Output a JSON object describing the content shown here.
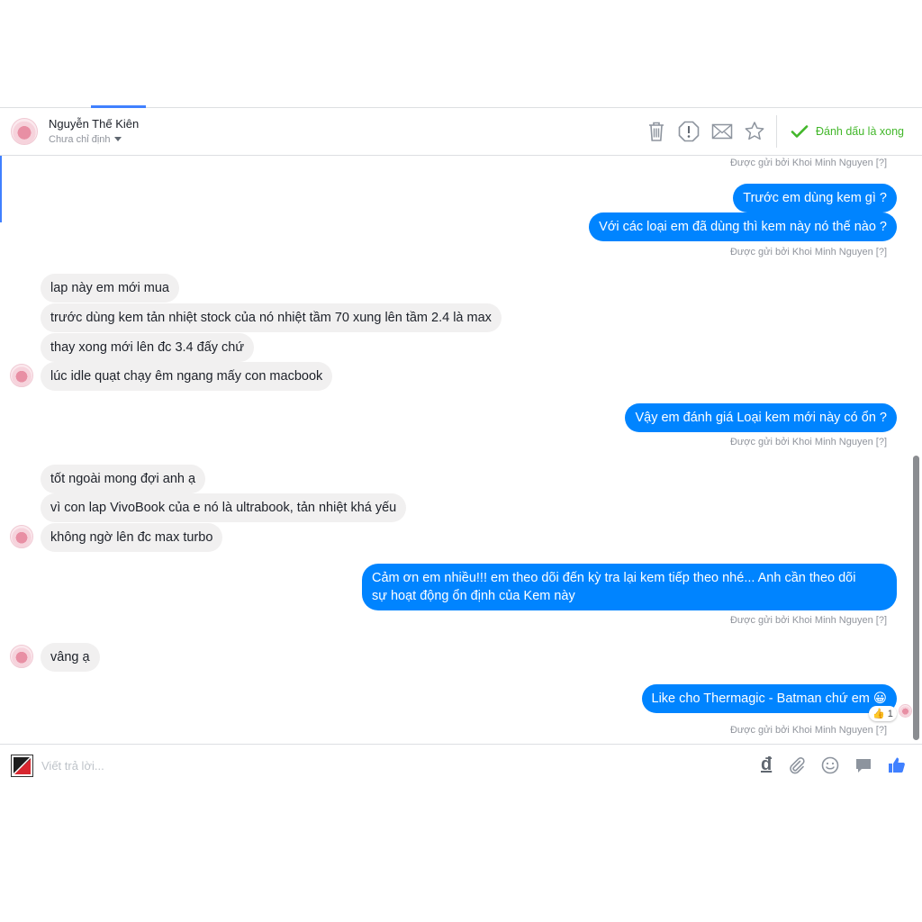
{
  "conversation": {
    "contact_name": "Nguyễn Thế Kiên",
    "contact_status": "Chưa chỉ định",
    "mark_done_label": "Đánh dấu là xong"
  },
  "icons": {
    "trash": "trash-icon",
    "alert": "alert-icon",
    "mail": "mail-icon",
    "star": "star-icon",
    "check": "check-icon"
  },
  "messages": {
    "sent_by": "Được gửi bởi Khoi Minh Nguyen [?]",
    "m1": "Trước em dùng kem gì ?",
    "m2": "Với các loại em đã dùng thì kem này nó thế nào ?",
    "m3": "lap này em mới mua",
    "m4": "trước dùng kem tản nhiệt stock của nó nhiệt tầm 70 xung lên tầm 2.4 là max",
    "m5": "thay xong mới lên đc 3.4 đấy chứ",
    "m6": "lúc idle quạt chạy êm ngang mấy con macbook",
    "m7": "Vậy em đánh giá Loại kem mới này có ổn ?",
    "m8": "tốt ngoài mong đợi anh ạ",
    "m9": "vì con lap VivoBook của e nó là ultrabook, tản nhiệt khá yếu",
    "m10": "không ngờ lên đc max turbo",
    "m11_line1": "Cảm ơn em nhiều!!! em theo dõi đến kỳ tra lại kem tiếp theo nhé... Anh cần theo dõi",
    "m11_line2": "sự hoạt động ổn định của Kem này",
    "m12": "vâng ạ",
    "m13": "Like cho Thermagic - Batman chứ em 😀",
    "reaction_count": "1"
  },
  "composer": {
    "placeholder": "Viết trả lời...",
    "currency_symbol": "đ"
  },
  "colors": {
    "outgoing_bubble": "#0084ff",
    "incoming_bubble": "#f1f0f0",
    "done_green": "#42b72a",
    "like_blue": "#4080ff"
  }
}
